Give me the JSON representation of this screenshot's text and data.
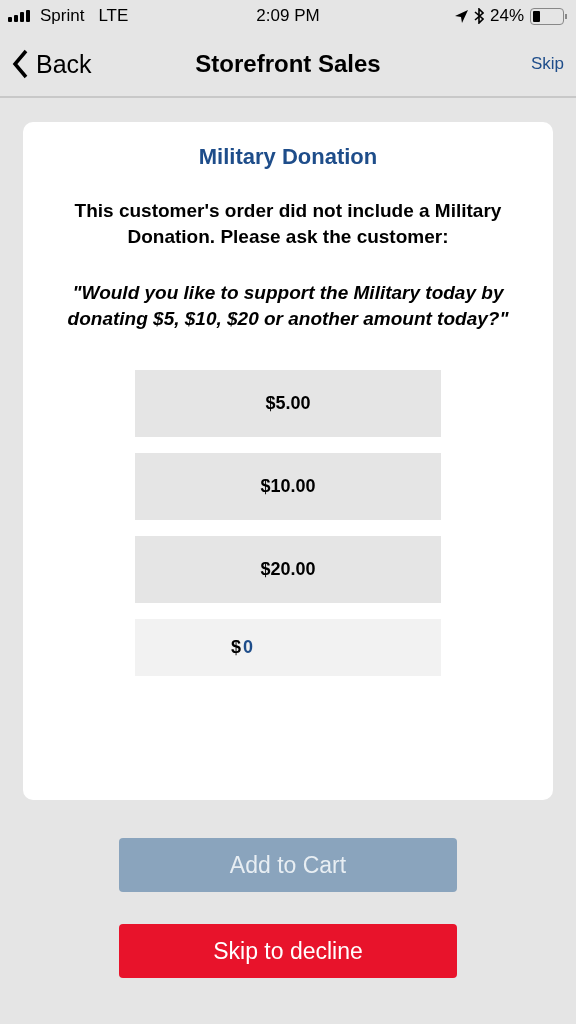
{
  "status_bar": {
    "carrier": "Sprint",
    "network": "LTE",
    "time": "2:09 PM",
    "battery": "24%"
  },
  "nav": {
    "back": "Back",
    "title": "Storefront Sales",
    "action": "Skip"
  },
  "card": {
    "title": "Military Donation",
    "message": "This customer's order did not include a Military Donation. Please ask the customer:",
    "quote": "\"Would you like to support the Military today by donating $5, $10, $20 or another amount today?\"",
    "amounts": [
      "$5.00",
      "$10.00",
      "$20.00"
    ],
    "custom": {
      "prefix": "$",
      "value": "0"
    }
  },
  "buttons": [
    {
      "kind": "primary",
      "label": "Add to Cart",
      "disabled": true
    },
    {
      "kind": "decline",
      "label": "Skip to decline",
      "disabled": false
    }
  ]
}
